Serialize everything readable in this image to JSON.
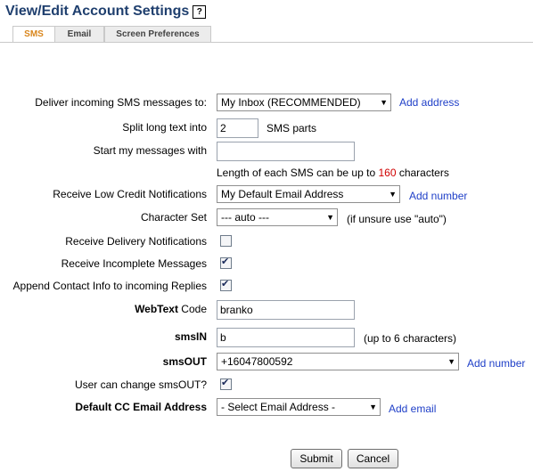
{
  "page": {
    "title": "View/Edit Account Settings",
    "help_symbol": "?"
  },
  "tabs": [
    {
      "label": "SMS",
      "active": true
    },
    {
      "label": "Email",
      "active": false
    },
    {
      "label": "Screen Preferences",
      "active": false
    }
  ],
  "form": {
    "deliver": {
      "label": "Deliver incoming SMS messages to:",
      "value": "My Inbox (RECOMMENDED)",
      "link": "Add address"
    },
    "split": {
      "label": "Split long text into",
      "value": "2",
      "suffix": "SMS parts"
    },
    "start": {
      "label": "Start my messages with",
      "value": ""
    },
    "length_note": {
      "prefix": "Length of each SMS can be up to ",
      "number": "160",
      "suffix": " characters"
    },
    "low_credit": {
      "label": "Receive Low Credit Notifications",
      "value": "My Default Email Address",
      "link": "Add number"
    },
    "charset": {
      "label": "Character Set",
      "value": "--- auto ---",
      "note": "(if unsure use \"auto\")"
    },
    "delivery_notifications": {
      "label": "Receive Delivery Notifications",
      "checked": false
    },
    "incomplete_messages": {
      "label": "Receive Incomplete Messages",
      "checked": true
    },
    "append_contact": {
      "label": "Append Contact Info to incoming Replies",
      "checked": true
    },
    "webtext_code": {
      "label_bold": "WebText",
      "label_rest": " Code",
      "value": "branko"
    },
    "smsin": {
      "label": "smsIN",
      "value": "b",
      "note": "(up to 6 characters)"
    },
    "smsout": {
      "label": "smsOUT",
      "value": "+16047800592",
      "link": "Add number"
    },
    "user_change": {
      "label": "User can change smsOUT?",
      "checked": true
    },
    "default_cc": {
      "label": "Default CC Email Address",
      "value": "- Select Email Address -",
      "link": "Add email"
    }
  },
  "buttons": {
    "submit": "Submit",
    "cancel": "Cancel"
  },
  "icons": {
    "dropdown": "chevron-down-icon",
    "checkmark": "check-icon",
    "help": "help-icon"
  }
}
